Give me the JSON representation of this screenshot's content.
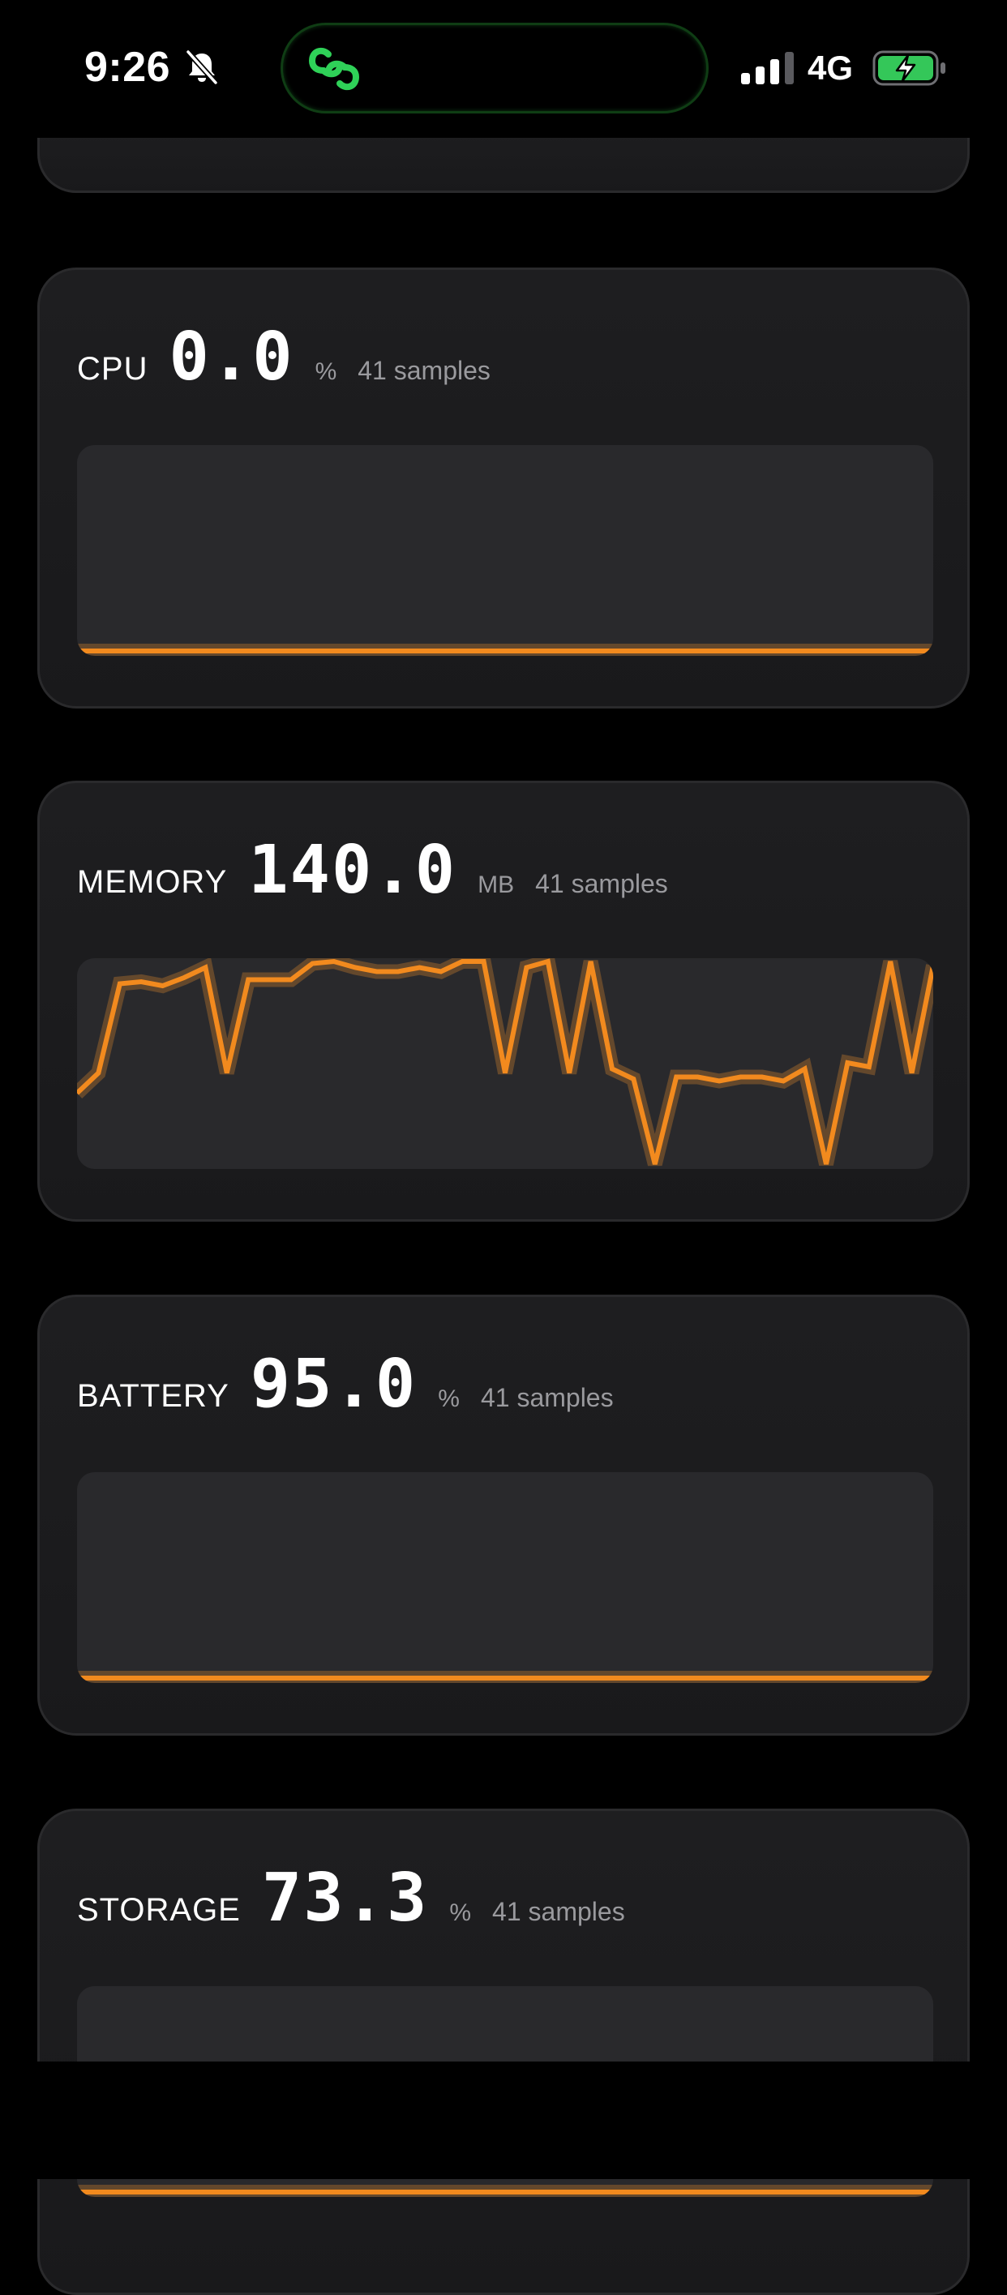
{
  "status_bar": {
    "time": "9:26",
    "network": "4G",
    "icons": [
      "bell-slash-icon",
      "link-icon",
      "signal-icon",
      "battery-charging-icon"
    ],
    "accent_color": "#2fd158",
    "battery_fill_color": "#34c759"
  },
  "cards": [
    {
      "name": "CPU",
      "value": "0.0",
      "unit": "%",
      "samples": "41 samples"
    },
    {
      "name": "MEMORY",
      "value": "140.0",
      "unit": "MB",
      "samples": "41 samples"
    },
    {
      "name": "BATTERY",
      "value": "95.0",
      "unit": "%",
      "samples": "41 samples"
    },
    {
      "name": "STORAGE",
      "value": "73.3",
      "unit": "%",
      "samples": "41 samples"
    }
  ],
  "chart_style": {
    "line_color": "#f28a1e",
    "glow_color": "#ff9a2e",
    "background": "#29292c"
  },
  "chart_data": [
    {
      "type": "line",
      "samples": 41,
      "values": [
        0,
        0,
        0,
        0,
        0,
        0,
        0,
        0,
        0,
        0,
        0,
        0,
        0,
        0,
        0,
        0,
        0,
        0,
        0,
        0,
        0,
        0,
        0,
        0,
        0,
        0,
        0,
        0,
        0,
        0,
        0,
        0,
        0,
        0,
        0,
        0,
        0,
        0,
        0,
        0,
        0
      ]
    },
    {
      "type": "line",
      "samples": 41,
      "values": [
        0.35,
        0.45,
        0.89,
        0.9,
        0.88,
        0.92,
        0.97,
        0.45,
        0.91,
        0.91,
        0.91,
        0.99,
        1.0,
        0.97,
        0.95,
        0.95,
        0.97,
        0.95,
        1.0,
        1.0,
        0.45,
        0.97,
        1.0,
        0.45,
        1.0,
        0.47,
        0.42,
        0.0,
        0.43,
        0.43,
        0.41,
        0.43,
        0.43,
        0.41,
        0.47,
        0.0,
        0.5,
        0.48,
        1.0,
        0.45,
        0.98
      ]
    },
    {
      "type": "line",
      "samples": 41,
      "values": [
        0,
        0,
        0,
        0,
        0,
        0,
        0,
        0,
        0,
        0,
        0,
        0,
        0,
        0,
        0,
        0,
        0,
        0,
        0,
        0,
        0,
        0,
        0,
        0,
        0,
        0,
        0,
        0,
        0,
        0,
        0,
        0,
        0,
        0,
        0,
        0,
        0,
        0,
        0,
        0,
        0
      ]
    },
    {
      "type": "line",
      "samples": 41,
      "values": [
        0,
        0,
        0,
        0,
        0,
        0,
        0,
        0,
        0,
        0,
        0,
        0,
        0,
        0,
        0,
        0,
        0,
        0,
        0,
        0,
        0,
        0,
        0,
        0,
        0,
        0,
        0,
        0,
        0,
        0,
        0,
        0,
        0,
        0,
        0,
        0,
        0,
        0,
        0,
        0,
        0
      ]
    }
  ]
}
